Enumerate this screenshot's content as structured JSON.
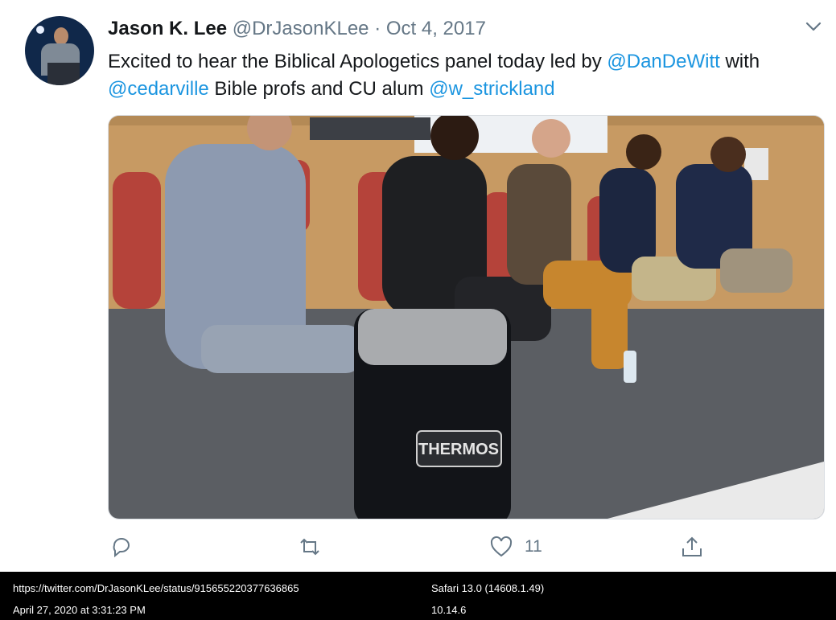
{
  "tweet": {
    "name": "Jason K. Lee",
    "handle": "@DrJasonKLee",
    "separator": "·",
    "date": "Oct 4, 2017",
    "text": {
      "p1": "Excited to hear the Biblical Apologetics panel today led by ",
      "m1": "@DanDeWitt",
      "p2": " with",
      "m2": "@cedarville",
      "p3": " Bible profs and CU alum ",
      "m3": "@w_strickland"
    },
    "actions": {
      "reply_icon": "reply-icon",
      "retweet_icon": "retweet-icon",
      "like_icon": "heart-icon",
      "like_count": "11",
      "share_icon": "share-icon"
    },
    "photo_brand": "THERMOS"
  },
  "status_bar": {
    "url": "https://twitter.com/DrJasonKLee/status/915655220377636865",
    "timestamp": "April 27, 2020 at 3:31:23 PM",
    "browser": "Safari 13.0 (14608.1.49)",
    "os": "10.14.6"
  },
  "colors": {
    "link": "#1b95e0",
    "text": "#14171a",
    "muted": "#657786"
  }
}
